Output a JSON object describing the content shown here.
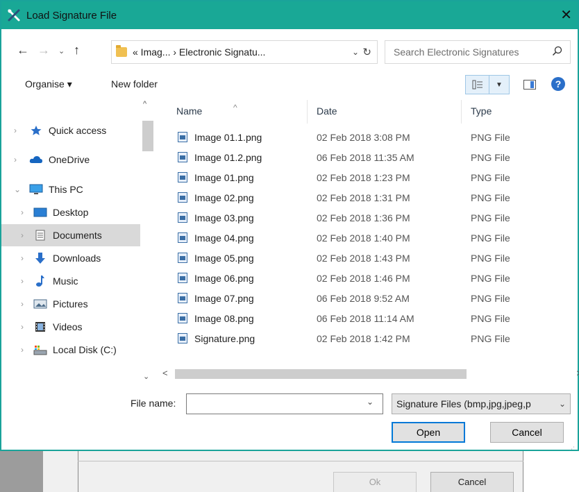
{
  "window": {
    "title": "Load Signature File",
    "close": "✕"
  },
  "address": {
    "path": "« Imag... › Electronic Signatu...",
    "search_placeholder": "Search Electronic Signatures"
  },
  "toolbar": {
    "organise": "Organise ▾",
    "new_folder": "New folder",
    "help": "?"
  },
  "nav": {
    "items": [
      {
        "label": "Quick access",
        "icon": "star-icon"
      },
      {
        "label": "OneDrive",
        "icon": "cloud-icon"
      },
      {
        "label": "This PC",
        "icon": "monitor-icon"
      },
      {
        "label": "Desktop",
        "icon": "desktop-icon"
      },
      {
        "label": "Documents",
        "icon": "document-icon"
      },
      {
        "label": "Downloads",
        "icon": "download-icon"
      },
      {
        "label": "Music",
        "icon": "music-icon"
      },
      {
        "label": "Pictures",
        "icon": "pictures-icon"
      },
      {
        "label": "Videos",
        "icon": "videos-icon"
      },
      {
        "label": "Local Disk (C:)",
        "icon": "disk-icon"
      }
    ],
    "selected": "Documents"
  },
  "files": {
    "columns": {
      "name": "Name",
      "date": "Date",
      "type": "Type"
    },
    "rows": [
      {
        "name": "Image 01.1.png",
        "date": "02 Feb 2018 3:08 PM",
        "type": "PNG File"
      },
      {
        "name": "Image 01.2.png",
        "date": "06 Feb 2018 11:35 AM",
        "type": "PNG File"
      },
      {
        "name": "Image 01.png",
        "date": "02 Feb 2018 1:23 PM",
        "type": "PNG File"
      },
      {
        "name": "Image 02.png",
        "date": "02 Feb 2018 1:31 PM",
        "type": "PNG File"
      },
      {
        "name": "Image 03.png",
        "date": "02 Feb 2018 1:36 PM",
        "type": "PNG File"
      },
      {
        "name": "Image 04.png",
        "date": "02 Feb 2018 1:40 PM",
        "type": "PNG File"
      },
      {
        "name": "Image 05.png",
        "date": "02 Feb 2018 1:43 PM",
        "type": "PNG File"
      },
      {
        "name": "Image 06.png",
        "date": "02 Feb 2018 1:46 PM",
        "type": "PNG File"
      },
      {
        "name": "Image 07.png",
        "date": "06 Feb 2018 9:52 AM",
        "type": "PNG File"
      },
      {
        "name": "Image 08.png",
        "date": "06 Feb 2018 11:14 AM",
        "type": "PNG File"
      },
      {
        "name": "Signature.png",
        "date": "02 Feb 2018 1:42 PM",
        "type": "PNG File"
      }
    ]
  },
  "bottom": {
    "file_name_label": "File name:",
    "file_name_value": "",
    "filter": "Signature Files (bmp,jpg,jpeg,p",
    "open": "Open",
    "cancel": "Cancel"
  },
  "background_app": {
    "ok": "Ok",
    "cancel": "Cancel"
  },
  "colors": {
    "titlebar": "#19a896",
    "accent": "#0078d7",
    "selected": "#d9d9d9"
  }
}
